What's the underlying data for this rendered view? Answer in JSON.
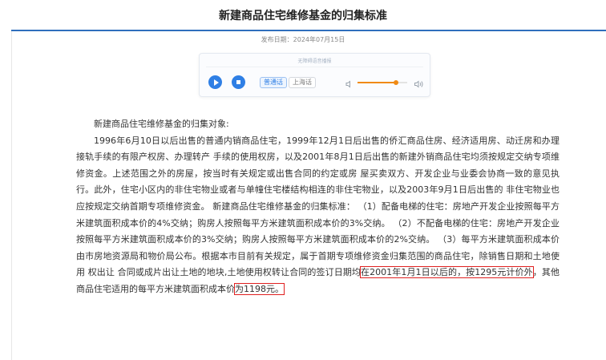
{
  "article": {
    "title": "新建商品住宅维修基金的归集标准",
    "publish_date": "发布日期：2024年07月15日"
  },
  "player": {
    "caption": "无障碍语音播报",
    "play_icon": "play-icon",
    "stop_icon": "stop-icon",
    "lang_mandarin": "普通话",
    "lang_shanghai": "上海话",
    "volume_low_icon": "volume-low-icon",
    "volume_high_icon": "volume-high-icon",
    "volume_level": 0.78,
    "accent_color": "#2f7fe5",
    "slider_color": "#f08a14"
  },
  "body": {
    "intro": "新建商品住宅维修基金的归集对象:",
    "p_before_hl1": "1996年6月10日以后出售的普通内销商品住宅，1999年12月1日后出售的侨汇商品住房、经济适用房、动迁房和办理接轨手续的有限产权房、办理转产 手续的使用权房，以及2001年8月1日后出售的新建外销商品住宅均须按规定交纳专项维修资金。上述范围之外的房屋，按当时有关规定或出售合同的约定或房 屋买卖双方、开发企业与业委会协商一致的意见执行。此外，住宅小区内的非住宅物业或者与单幢住宅楼结构相连的非住宅物业，以及2003年9月1日后出售的 非住宅物业也应按规定交纳首期专项维修资金。 新建商品住宅维修基金的归集标准： （1）配备电梯的住宅：房地产开发企业按照每平方米建筑面积成本价的4%交纳；购房人按照每平方米建筑面积成本价的3%交纳。 （2）不配备电梯的住宅：房地产开发企业按照每平方米建筑面积成本价的3%交纳；购房人按照每平方米建筑面积成本价的2%交纳。 （3）每平方米建筑面积成本价由市房地资源局和物价局公布。根据本市目前有关规定，属于首期专项维修资金归集范围的商品住宅，除销售日期和土地使用 权出让 合同或成片出让土地的地块,土地使用权转让合同的签订日期均",
    "highlight_1": "在2001年1月1日以后的，按1295元计价外",
    "p_between": "，其他商品住宅适用的每平方米建筑面积成本价",
    "highlight_2": "为1198元。",
    "highlight_color": "#e02020"
  }
}
